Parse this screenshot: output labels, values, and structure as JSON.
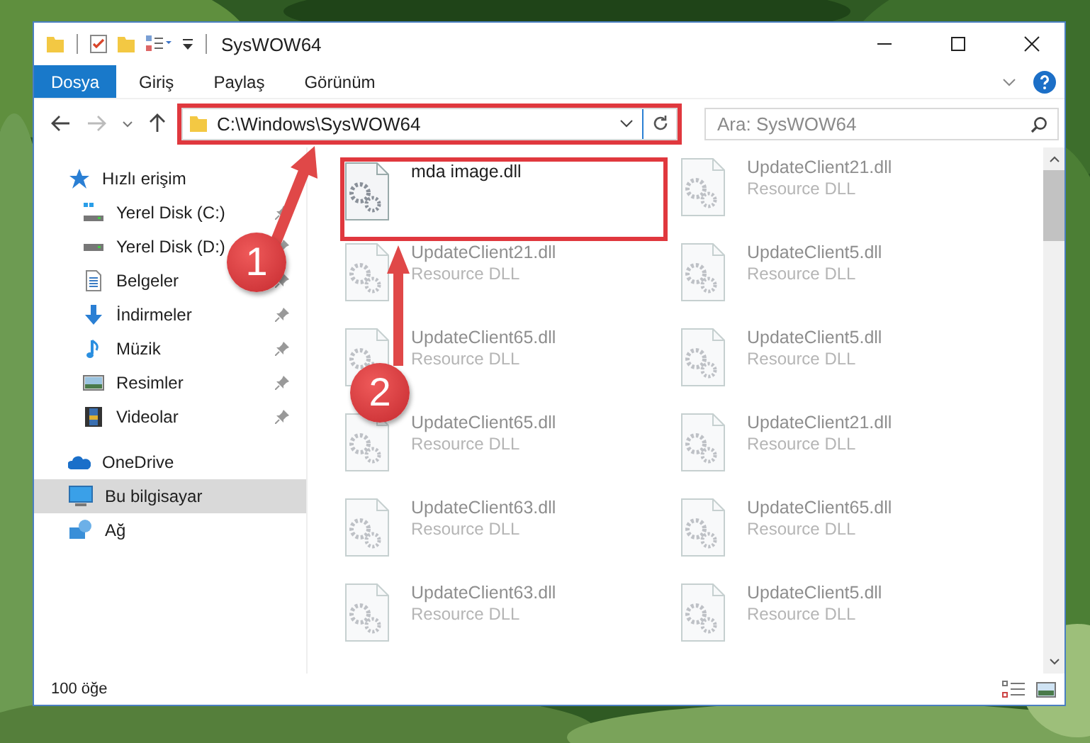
{
  "window": {
    "title": "SysWOW64"
  },
  "ribbon_tabs": [
    {
      "label": "Dosya",
      "selected": true
    },
    {
      "label": "Giriş",
      "selected": false
    },
    {
      "label": "Paylaş",
      "selected": false
    },
    {
      "label": "Görünüm",
      "selected": false
    }
  ],
  "address": {
    "path": "C:\\Windows\\SysWOW64",
    "highlighted": true
  },
  "search": {
    "placeholder": "Ara: SysWOW64"
  },
  "nav": [
    {
      "label": "Hızlı erişim",
      "kind": "star",
      "selected": false,
      "children": [
        {
          "label": "Yerel Disk (C:)",
          "kind": "drive-c",
          "pinned": true,
          "selected": false
        },
        {
          "label": "Yerel Disk (D:)",
          "kind": "drive",
          "pinned": true,
          "selected": false
        },
        {
          "label": "Belgeler",
          "kind": "document",
          "pinned": true,
          "selected": false
        },
        {
          "label": "İndirmeler",
          "kind": "download",
          "pinned": true,
          "selected": false
        },
        {
          "label": "Müzik",
          "kind": "music",
          "pinned": true,
          "selected": false
        },
        {
          "label": "Resimler",
          "kind": "pictures",
          "pinned": true,
          "selected": false
        },
        {
          "label": "Videolar",
          "kind": "video",
          "pinned": true,
          "selected": false
        }
      ]
    },
    {
      "label": "OneDrive",
      "kind": "cloud",
      "selected": false
    },
    {
      "label": "Bu bilgisayar",
      "kind": "pc",
      "selected": true
    },
    {
      "label": "Ağ",
      "kind": "network",
      "selected": false
    }
  ],
  "files": [
    {
      "name": "mda image.dll",
      "faded": false,
      "highlighted": true
    },
    {
      "name": "UpdateClient21.dll",
      "type": "Resource DLL",
      "faded": true
    },
    {
      "name": "UpdateClient21.dll",
      "type": "Resource DLL",
      "faded": true
    },
    {
      "name": "UpdateClient5.dll",
      "type": "Resource DLL",
      "faded": true
    },
    {
      "name": "UpdateClient65.dll",
      "type": "Resource DLL",
      "faded": true
    },
    {
      "name": "UpdateClient5.dll",
      "type": "Resource DLL",
      "faded": true
    },
    {
      "name": "UpdateClient65.dll",
      "type": "Resource DLL",
      "faded": true
    },
    {
      "name": "UpdateClient21.dll",
      "type": "Resource DLL",
      "faded": true
    },
    {
      "name": "UpdateClient63.dll",
      "type": "Resource DLL",
      "faded": true
    },
    {
      "name": "UpdateClient65.dll",
      "type": "Resource DLL",
      "faded": true
    },
    {
      "name": "UpdateClient63.dll",
      "type": "Resource DLL",
      "faded": true
    },
    {
      "name": "UpdateClient5.dll",
      "type": "Resource DLL",
      "faded": true
    }
  ],
  "status_bar": {
    "count": "100 öğe"
  },
  "annotations": [
    {
      "number": "1"
    },
    {
      "number": "2"
    }
  ]
}
